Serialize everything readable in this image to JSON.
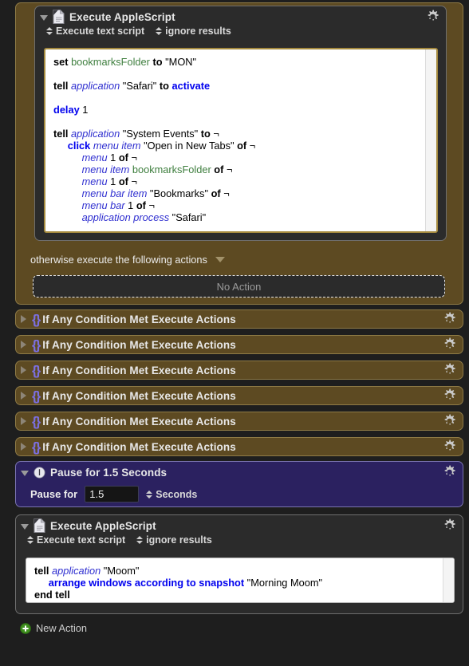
{
  "blocks": {
    "if_block_1": {
      "type": "if-otherwise-container",
      "otherwise_label": "otherwise execute the following actions",
      "no_action_label": "No Action",
      "action": {
        "title": "Execute AppleScript",
        "icon": "applescript-document-icon",
        "gear": "gear-icon",
        "popup_script_type": "Execute text script",
        "popup_results": "ignore results",
        "script_lines": [
          [
            {
              "t": "set ",
              "c": "bold"
            },
            {
              "t": "bookmarksFolder",
              "c": "var"
            },
            {
              "t": " ",
              "c": "str"
            },
            {
              "t": "to",
              "c": "bold"
            },
            {
              "t": " \"MON\"",
              "c": "str"
            }
          ],
          [],
          [
            {
              "t": "tell ",
              "c": "bold"
            },
            {
              "t": "application",
              "c": "cls"
            },
            {
              "t": " \"Safari\" ",
              "c": "str"
            },
            {
              "t": "to ",
              "c": "bold"
            },
            {
              "t": "activate",
              "c": "kw"
            }
          ],
          [],
          [
            {
              "t": "delay",
              "c": "kw"
            },
            {
              "t": " 1",
              "c": "num"
            }
          ],
          [],
          [
            {
              "t": "tell ",
              "c": "bold"
            },
            {
              "t": "application",
              "c": "cls"
            },
            {
              "t": " \"System Events\" ",
              "c": "str"
            },
            {
              "t": "to",
              "c": "bold"
            },
            {
              "t": " ¬",
              "c": "str"
            }
          ],
          [
            {
              "t": "     ",
              "c": "str"
            },
            {
              "t": "click ",
              "c": "kw"
            },
            {
              "t": "menu item",
              "c": "cls"
            },
            {
              "t": " \"Open in New Tabs\" ",
              "c": "str"
            },
            {
              "t": "of",
              "c": "bold"
            },
            {
              "t": " ¬",
              "c": "str"
            }
          ],
          [
            {
              "t": "          ",
              "c": "str"
            },
            {
              "t": "menu",
              "c": "cls"
            },
            {
              "t": " 1 ",
              "c": "num"
            },
            {
              "t": "of",
              "c": "bold"
            },
            {
              "t": " ¬",
              "c": "str"
            }
          ],
          [
            {
              "t": "          ",
              "c": "str"
            },
            {
              "t": "menu item",
              "c": "cls"
            },
            {
              "t": " ",
              "c": "str"
            },
            {
              "t": "bookmarksFolder",
              "c": "var"
            },
            {
              "t": " ",
              "c": "str"
            },
            {
              "t": "of",
              "c": "bold"
            },
            {
              "t": " ¬",
              "c": "str"
            }
          ],
          [
            {
              "t": "          ",
              "c": "str"
            },
            {
              "t": "menu",
              "c": "cls"
            },
            {
              "t": " 1 ",
              "c": "num"
            },
            {
              "t": "of",
              "c": "bold"
            },
            {
              "t": " ¬",
              "c": "str"
            }
          ],
          [
            {
              "t": "          ",
              "c": "str"
            },
            {
              "t": "menu bar item",
              "c": "cls"
            },
            {
              "t": " \"Bookmarks\" ",
              "c": "str"
            },
            {
              "t": "of",
              "c": "bold"
            },
            {
              "t": " ¬",
              "c": "str"
            }
          ],
          [
            {
              "t": "          ",
              "c": "str"
            },
            {
              "t": "menu bar",
              "c": "cls"
            },
            {
              "t": " 1 ",
              "c": "num"
            },
            {
              "t": "of",
              "c": "bold"
            },
            {
              "t": " ¬",
              "c": "str"
            }
          ],
          [
            {
              "t": "          ",
              "c": "str"
            },
            {
              "t": "application process",
              "c": "cls"
            },
            {
              "t": " \"Safari\"",
              "c": "str"
            }
          ]
        ]
      }
    },
    "collapsed_rows": [
      {
        "title": "If Any Condition Met Execute Actions",
        "icon": "brace-icon",
        "gear": "gear-icon"
      },
      {
        "title": "If Any Condition Met Execute Actions",
        "icon": "brace-icon",
        "gear": "gear-icon"
      },
      {
        "title": "If Any Condition Met Execute Actions",
        "icon": "brace-icon",
        "gear": "gear-icon"
      },
      {
        "title": "If Any Condition Met Execute Actions",
        "icon": "brace-icon",
        "gear": "gear-icon"
      },
      {
        "title": "If Any Condition Met Execute Actions",
        "icon": "brace-icon",
        "gear": "gear-icon"
      },
      {
        "title": "If Any Condition Met Execute Actions",
        "icon": "brace-icon",
        "gear": "gear-icon"
      }
    ],
    "pause": {
      "title": "Pause for 1.5 Seconds",
      "icon": "clock-icon",
      "gear": "gear-icon",
      "field_label": "Pause for",
      "value": "1.5",
      "unit": "Seconds"
    },
    "applescript_2": {
      "title": "Execute AppleScript",
      "icon": "applescript-document-icon",
      "gear": "gear-icon",
      "popup_script_type": "Execute text script",
      "popup_results": "ignore results",
      "script_lines": [
        [
          {
            "t": "tell ",
            "c": "bold"
          },
          {
            "t": "application",
            "c": "cls"
          },
          {
            "t": " \"Moom\"",
            "c": "str"
          }
        ],
        [
          {
            "t": "     ",
            "c": "str"
          },
          {
            "t": "arrange windows according to snapshot",
            "c": "kw"
          },
          {
            "t": " \"Morning Moom\"",
            "c": "str"
          }
        ],
        [
          {
            "t": "end tell",
            "c": "bold"
          }
        ]
      ]
    }
  },
  "footer": {
    "new_action_label": "New Action",
    "new_action_icon": "plus-circle-icon"
  },
  "colors": {
    "canvas_bg": "#1e1e1e",
    "container_brown": "#5d4a22",
    "action_dark": "#2b2b2b",
    "pause_purple": "#2b2160",
    "accent_green": "#4a9a27",
    "brace_purple": "#7b6fe0",
    "editor_border": "#a58a3e"
  }
}
